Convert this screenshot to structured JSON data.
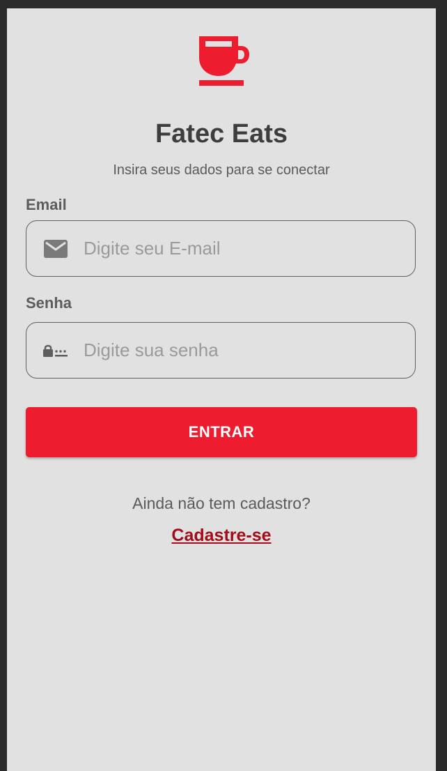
{
  "app": {
    "title": "Fatec Eats",
    "subtitle": "Insira seus dados para se conectar",
    "logo_icon": "coffee-cup-icon",
    "accent_color": "#ed1c2e"
  },
  "email": {
    "label": "Email",
    "placeholder": "Digite seu E-mail",
    "value": "",
    "icon": "envelope-icon"
  },
  "password": {
    "label": "Senha",
    "placeholder": "Digite sua senha",
    "value": "",
    "icon": "password-lock-icon"
  },
  "login_button": {
    "label": "ENTRAR"
  },
  "signup": {
    "prompt": "Ainda não tem cadastro?",
    "link_label": "Cadastre-se",
    "link_color": "#a20d1a"
  }
}
